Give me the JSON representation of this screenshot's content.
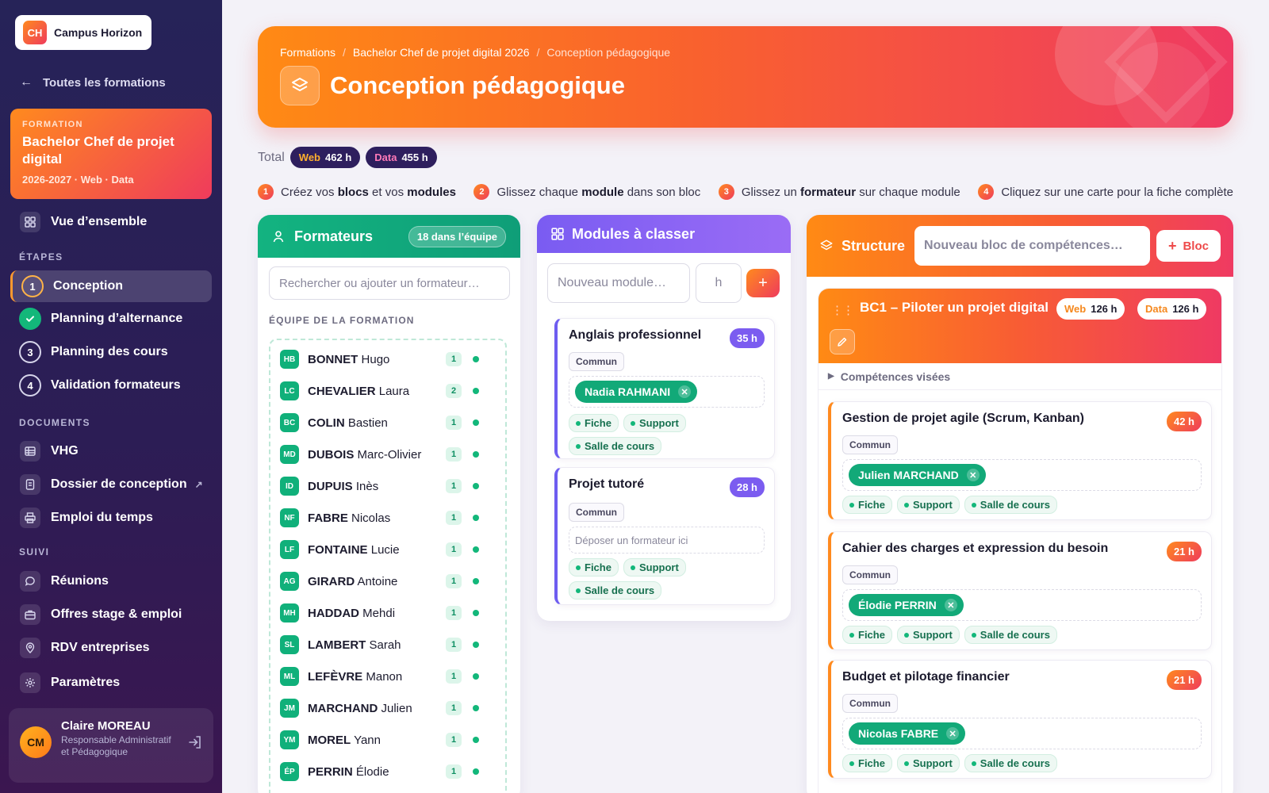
{
  "app": {
    "logo_initials": "CH",
    "logo_name": "Campus Horizon"
  },
  "sidebar": {
    "back_label": "Toutes les formations",
    "formation": {
      "kicker": "FORMATION",
      "title": "Bachelor Chef de projet digital",
      "subtitle": "2026-2027 · Web · Data"
    },
    "overview_label": "Vue d’ensemble",
    "section_etapes": "ÉTAPES",
    "steps": [
      {
        "num": "1",
        "label": "Conception",
        "state": "current"
      },
      {
        "num": "",
        "label": "Planning d’alternance",
        "state": "done"
      },
      {
        "num": "3",
        "label": "Planning des cours",
        "state": "todo"
      },
      {
        "num": "4",
        "label": "Validation formateurs",
        "state": "todo"
      }
    ],
    "section_documents": "DOCUMENTS",
    "documents": [
      {
        "label": "VHG",
        "icon": "table-icon"
      },
      {
        "label": "Dossier de conception",
        "icon": "document-icon",
        "external": "↗"
      },
      {
        "label": "Emploi du temps",
        "icon": "printer-icon"
      }
    ],
    "section_suivi": "SUIVI",
    "suivi": [
      {
        "label": "Réunions",
        "icon": "chat-icon"
      },
      {
        "label": "Offres stage & emploi",
        "icon": "briefcase-icon"
      },
      {
        "label": "RDV entreprises",
        "icon": "location-pin-icon"
      },
      {
        "label": "Paramètres",
        "icon": "gear-icon"
      }
    ],
    "user": {
      "initials": "CM",
      "name": "Claire MOREAU",
      "role": "Responsable Administratif et Pédagogique"
    }
  },
  "header": {
    "breadcrumb": [
      "Formations",
      "Bachelor Chef de projet digital 2026",
      "Conception pédagogique"
    ],
    "title": "Conception pédagogique"
  },
  "totals": {
    "label": "Total",
    "web_label": "Web",
    "web_value": "462 h",
    "data_label": "Data",
    "data_value": "455 h"
  },
  "instructions": [
    {
      "num": "1",
      "pre": "Créez vos ",
      "b1": "blocs",
      "mid": " et vos ",
      "b2": "modules",
      "post": ""
    },
    {
      "num": "2",
      "pre": "Glissez chaque ",
      "b1": "module",
      "mid": " dans son bloc",
      "b2": "",
      "post": ""
    },
    {
      "num": "3",
      "pre": "Glissez un ",
      "b1": "formateur",
      "mid": " sur chaque module",
      "b2": "",
      "post": ""
    },
    {
      "num": "4",
      "pre": "Cliquez sur une carte pour la fiche complète",
      "b1": "",
      "mid": "",
      "b2": "",
      "post": ""
    }
  ],
  "formateurs": {
    "title": "Formateurs",
    "badge": "18 dans l’équipe",
    "search_placeholder": "Rechercher ou ajouter un formateur…",
    "team_label": "ÉQUIPE DE LA FORMATION",
    "list": [
      {
        "ini": "HB",
        "last": "BONNET",
        "first": "Hugo",
        "count": "1"
      },
      {
        "ini": "LC",
        "last": "CHEVALIER",
        "first": "Laura",
        "count": "2"
      },
      {
        "ini": "BC",
        "last": "COLIN",
        "first": "Bastien",
        "count": "1"
      },
      {
        "ini": "MD",
        "last": "DUBOIS",
        "first": "Marc-Olivier",
        "count": "1"
      },
      {
        "ini": "ID",
        "last": "DUPUIS",
        "first": "Inès",
        "count": "1"
      },
      {
        "ini": "NF",
        "last": "FABRE",
        "first": "Nicolas",
        "count": "1"
      },
      {
        "ini": "LF",
        "last": "FONTAINE",
        "first": "Lucie",
        "count": "1"
      },
      {
        "ini": "AG",
        "last": "GIRARD",
        "first": "Antoine",
        "count": "1"
      },
      {
        "ini": "MH",
        "last": "HADDAD",
        "first": "Mehdi",
        "count": "1"
      },
      {
        "ini": "SL",
        "last": "LAMBERT",
        "first": "Sarah",
        "count": "1"
      },
      {
        "ini": "ML",
        "last": "LEFÈVRE",
        "first": "Manon",
        "count": "1"
      },
      {
        "ini": "JM",
        "last": "MARCHAND",
        "first": "Julien",
        "count": "1"
      },
      {
        "ini": "YM",
        "last": "MOREL",
        "first": "Yann",
        "count": "1"
      },
      {
        "ini": "ÉP",
        "last": "PERRIN",
        "first": "Élodie",
        "count": "1"
      }
    ]
  },
  "modules": {
    "title": "Modules à classer",
    "new_placeholder": "Nouveau module…",
    "hours_placeholder": "h",
    "add": "+",
    "cards": [
      {
        "title": "Anglais professionnel",
        "hours": "35 h",
        "tag": "Commun",
        "trainer": "Nadia RAHMANI",
        "drop": "",
        "chips": [
          "Fiche",
          "Support",
          "Salle de cours"
        ]
      },
      {
        "title": "Projet tutoré",
        "hours": "28 h",
        "tag": "Commun",
        "trainer": "",
        "drop": "Déposer un formateur ici",
        "chips": [
          "Fiche",
          "Support",
          "Salle de cours"
        ]
      }
    ]
  },
  "structure": {
    "title": "Structure",
    "new_bloc_placeholder": "Nouveau bloc de compétences…",
    "bloc_button": "Bloc",
    "bloc": {
      "title": "BC1 – Piloter un projet digital",
      "web_label": "Web",
      "web_value": "126 h",
      "data_label": "Data",
      "data_value": "126 h",
      "competences": "Compétences visées",
      "modules": [
        {
          "title": "Gestion de projet agile (Scrum, Kanban)",
          "hours": "42 h",
          "tag": "Commun",
          "trainer": "Julien MARCHAND",
          "chips": [
            "Fiche",
            "Support",
            "Salle de cours"
          ]
        },
        {
          "title": "Cahier des charges et expression du besoin",
          "hours": "21 h",
          "tag": "Commun",
          "trainer": "Élodie PERRIN",
          "chips": [
            "Fiche",
            "Support",
            "Salle de cours"
          ]
        },
        {
          "title": "Budget et pilotage financier",
          "hours": "21 h",
          "tag": "Commun",
          "trainer": "Nicolas FABRE",
          "chips": [
            "Fiche",
            "Support",
            "Salle de cours"
          ]
        }
      ]
    }
  },
  "colors": {
    "accent_orange": "#ff8a14",
    "accent_pink": "#ef3a62",
    "green": "#12a978",
    "purple": "#7b5cf0",
    "sidebar": "#262358"
  }
}
